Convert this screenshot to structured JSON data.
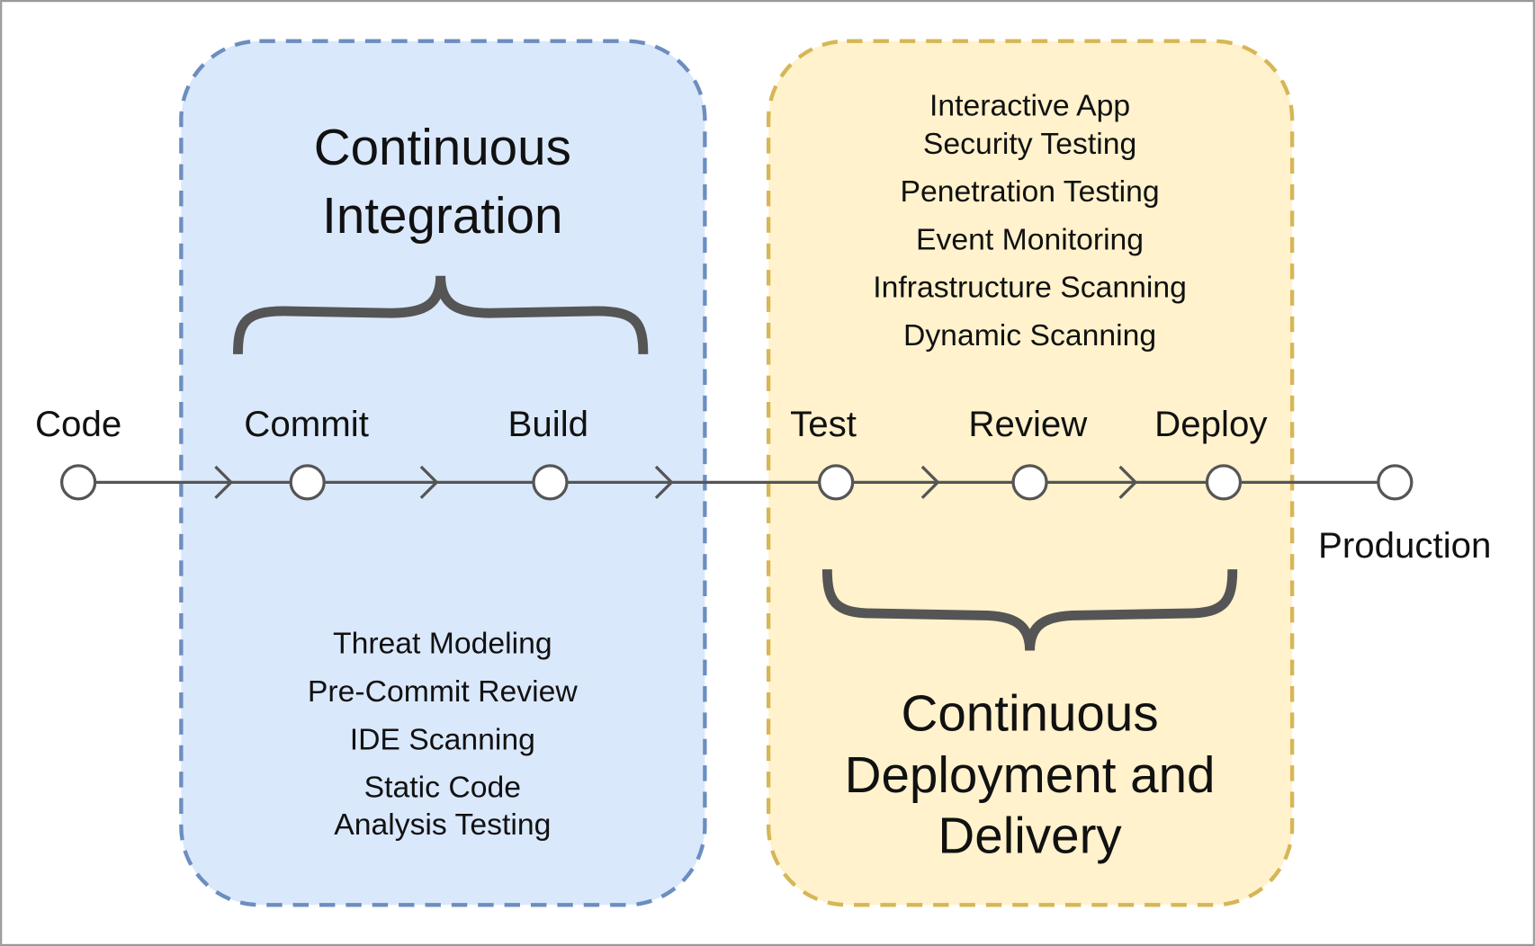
{
  "colors": {
    "ci_fill": "#dae8fc",
    "ci_stroke": "#6c8ebf",
    "cd_fill": "#fff2cc",
    "cd_stroke": "#d6b656",
    "line": "#555555",
    "frame": "#9a9a9a"
  },
  "stages": [
    "Code",
    "Commit",
    "Build",
    "Test",
    "Review",
    "Deploy",
    "Production"
  ],
  "ci": {
    "title": [
      "Continuous",
      "Integration"
    ],
    "items": [
      "Threat Modeling",
      "Pre-Commit Review",
      "IDE Scanning",
      "Static Code",
      "Analysis Testing"
    ]
  },
  "cd": {
    "title": [
      "Continuous",
      "Deployment and",
      "Delivery"
    ],
    "items": [
      "Interactive App",
      "Security Testing",
      "Penetration Testing",
      "Event Monitoring",
      "Infrastructure Scanning",
      "Dynamic Scanning"
    ]
  }
}
